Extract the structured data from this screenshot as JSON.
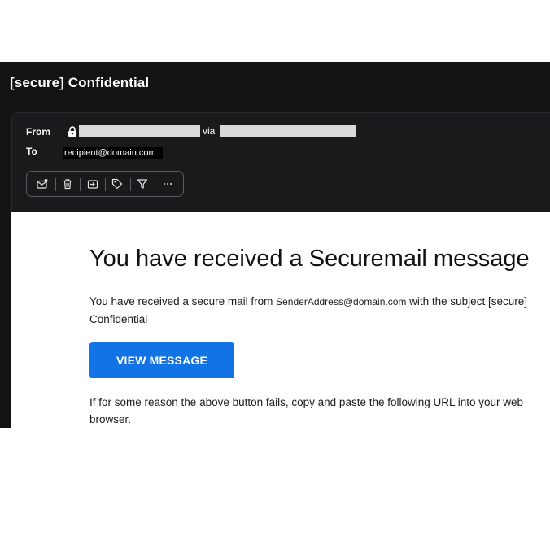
{
  "email": {
    "subject": "[secure] Confidential",
    "header": {
      "from_label": "From",
      "via_text": "via",
      "to_label": "To",
      "to_value": "recipient@domain.com"
    },
    "toolbar": [
      {
        "name": "mark-unread-icon"
      },
      {
        "name": "trash-icon"
      },
      {
        "name": "move-to-folder-icon"
      },
      {
        "name": "tag-icon"
      },
      {
        "name": "filter-icon"
      },
      {
        "name": "more-options-icon"
      }
    ],
    "body": {
      "heading": "You have received a Securemail message",
      "intro_before": "You have received a secure mail from ",
      "sender_address": "SenderAddress@domain.com",
      "intro_after": " with the subject [secure] Confidential",
      "button_label": "VIEW MESSAGE",
      "fallback_text": "If for some reason the above button fails, copy and paste the following URL into your web browser."
    }
  },
  "colors": {
    "window_bg": "#131316",
    "header_bg": "#1a1a1d",
    "button_bg": "#1273e6",
    "redaction": "#d9d9d9"
  }
}
